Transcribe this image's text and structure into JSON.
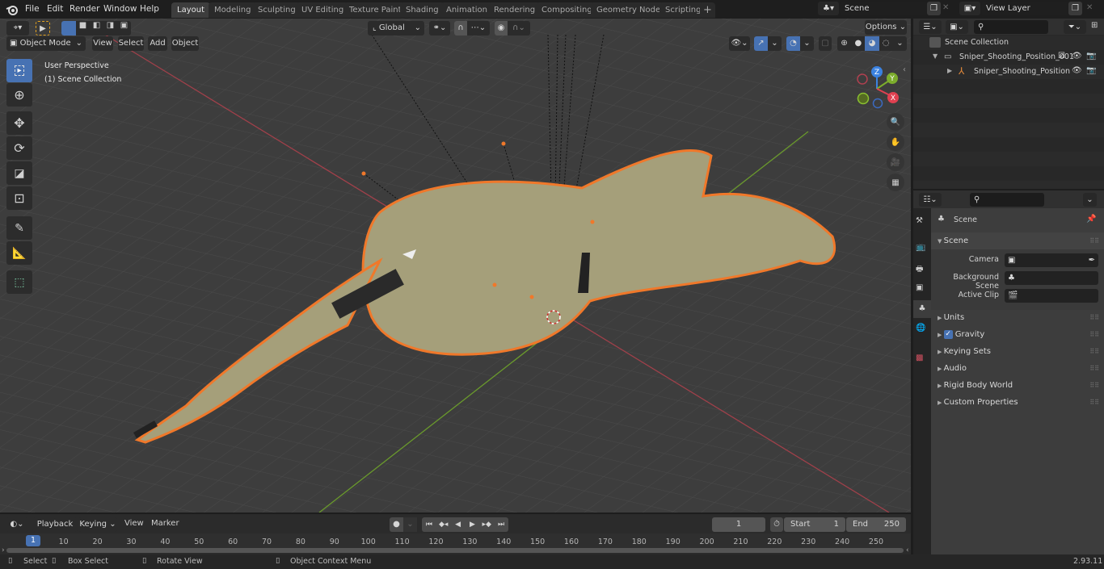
{
  "app": {
    "version": "2.93.11"
  },
  "menu": {
    "items": [
      "File",
      "Edit",
      "Render",
      "Window",
      "Help"
    ]
  },
  "workspaces": {
    "tabs": [
      "Layout",
      "Modeling",
      "Sculpting",
      "UV Editing",
      "Texture Paint",
      "Shading",
      "Animation",
      "Rendering",
      "Compositing",
      "Geometry Nodes",
      "Scripting"
    ],
    "active": "Layout",
    "add_label": "+"
  },
  "scene_selector": {
    "value": "Scene"
  },
  "view_layer_selector": {
    "value": "View Layer"
  },
  "viewport": {
    "mode": "Object Mode",
    "menus": [
      "View",
      "Select",
      "Add",
      "Object"
    ],
    "transform_orientation": "Global",
    "options_label": "Options",
    "overlay_text": {
      "line1": "User Perspective",
      "line2": "(1) Scene Collection"
    },
    "gizmo": {
      "x": "X",
      "y": "Y",
      "z": "Z"
    },
    "accent_color": "#4772b3",
    "selection_color": "#f0782a"
  },
  "toolbar": {
    "tools": [
      "select-box",
      "cursor",
      "move",
      "rotate",
      "scale",
      "transform",
      "annotate",
      "measure",
      "add-cube"
    ],
    "active": "select-box"
  },
  "outliner": {
    "root": "Scene Collection",
    "items": [
      {
        "label": "Sniper_Shooting_Position_001",
        "type": "collection",
        "expanded": true,
        "checked": true
      },
      {
        "label": "Sniper_Shooting_Position",
        "type": "armature",
        "expanded": false
      }
    ]
  },
  "properties": {
    "context_label": "Scene",
    "panel_title": "Scene",
    "fields": [
      {
        "label": "Camera",
        "value": ""
      },
      {
        "label": "Background Scene",
        "value": ""
      },
      {
        "label": "Active Clip",
        "value": ""
      }
    ],
    "sections": [
      {
        "label": "Units"
      },
      {
        "label": "Gravity",
        "checkbox": true
      },
      {
        "label": "Keying Sets"
      },
      {
        "label": "Audio"
      },
      {
        "label": "Rigid Body World"
      },
      {
        "label": "Custom Properties"
      }
    ]
  },
  "timeline": {
    "menus": [
      "Playback",
      "Keying",
      "View",
      "Marker"
    ],
    "current_frame": "1",
    "start_label": "Start",
    "start": "1",
    "end_label": "End",
    "end": "250",
    "ticks": [
      "10",
      "20",
      "30",
      "40",
      "50",
      "60",
      "70",
      "80",
      "90",
      "100",
      "110",
      "120",
      "130",
      "140",
      "150",
      "160",
      "170",
      "180",
      "190",
      "200",
      "210",
      "220",
      "230",
      "240",
      "250"
    ],
    "playhead_label": "1"
  },
  "statusbar": {
    "hints": [
      "Select",
      "Box Select",
      "Rotate View",
      "Object Context Menu"
    ]
  }
}
